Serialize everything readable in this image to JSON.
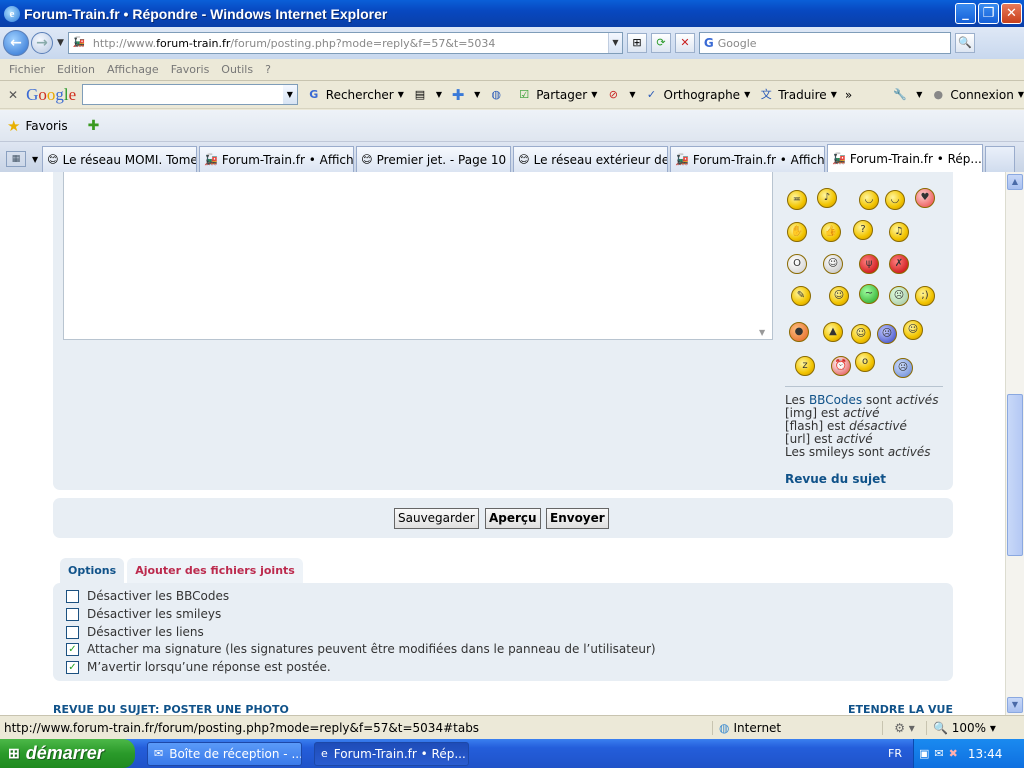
{
  "window": {
    "title": "Forum-Train.fr • Répondre - Windows Internet Explorer"
  },
  "address_bar": {
    "url_prefix": "http://www.",
    "url_domain": "forum-train.fr",
    "url_path": "/forum/posting.php?mode=reply&f=57&t=5034",
    "search_placeholder": "Google"
  },
  "menu": {
    "items": [
      "Fichier",
      "Edition",
      "Affichage",
      "Favoris",
      "Outils",
      "?"
    ]
  },
  "google_toolbar": {
    "logo": "Google",
    "search": "Rechercher",
    "share": "Partager",
    "spell": "Orthographe",
    "translate": "Traduire",
    "more": "»",
    "connect": "Connexion"
  },
  "favorites_bar": {
    "label": "Favoris"
  },
  "tabs": [
    {
      "label": "Le réseau MOMI. Tome II..."
    },
    {
      "label": "Forum-Train.fr • Afficher..."
    },
    {
      "label": "Premier jet. - Page 10"
    },
    {
      "label": "Le réseau extérieur de S..."
    },
    {
      "label": "Forum-Train.fr • Affiche..."
    },
    {
      "label": "Forum-Train.fr • Rép..."
    }
  ],
  "post_rules": {
    "line1_prefix": "Les ",
    "line1_link": "BBCodes",
    "line1_mid": " sont ",
    "line1_state": "activés",
    "line2_prefix": "[img] est ",
    "line2_state": "activé",
    "line3_prefix": "[flash] est ",
    "line3_state": "désactivé",
    "line4_prefix": "[url] est ",
    "line4_state": "activé",
    "line5_prefix": "Les smileys sont ",
    "line5_state": "activés",
    "topic_review": "Revue du sujet"
  },
  "buttons": {
    "save": "Sauvegarder",
    "preview": "Aperçu",
    "submit": "Envoyer"
  },
  "option_tabs": {
    "options": "Options",
    "attachments": "Ajouter des fichiers joints"
  },
  "options": [
    {
      "label": "Désactiver les BBCodes",
      "checked": false
    },
    {
      "label": "Désactiver les smileys",
      "checked": false
    },
    {
      "label": "Désactiver les liens",
      "checked": false
    },
    {
      "label": "Attacher ma signature (les signatures peuvent être modifiées dans le panneau de l’utilisateur)",
      "checked": true
    },
    {
      "label": "M’avertir lorsqu’une réponse est postée.",
      "checked": true
    }
  ],
  "footer_links": {
    "left": "REVUE DU SUJET: POSTER UNE PHOTO",
    "right": "ETENDRE LA VUE"
  },
  "status_bar": {
    "text": "http://www.forum-train.fr/forum/posting.php?mode=reply&f=57&t=5034#tabs",
    "zone": "Internet",
    "zoom": "100%"
  },
  "taskbar": {
    "start": "démarrer",
    "tasks": [
      {
        "label": "Boîte de réception - ..."
      },
      {
        "label": "Forum-Train.fr • Rép..."
      }
    ],
    "lang": "FR",
    "clock": "13:44"
  },
  "colors": {
    "link": "#105289",
    "panel": "#e8eef4",
    "attach_tab": "#bc2a4d",
    "check": "#21a121"
  }
}
